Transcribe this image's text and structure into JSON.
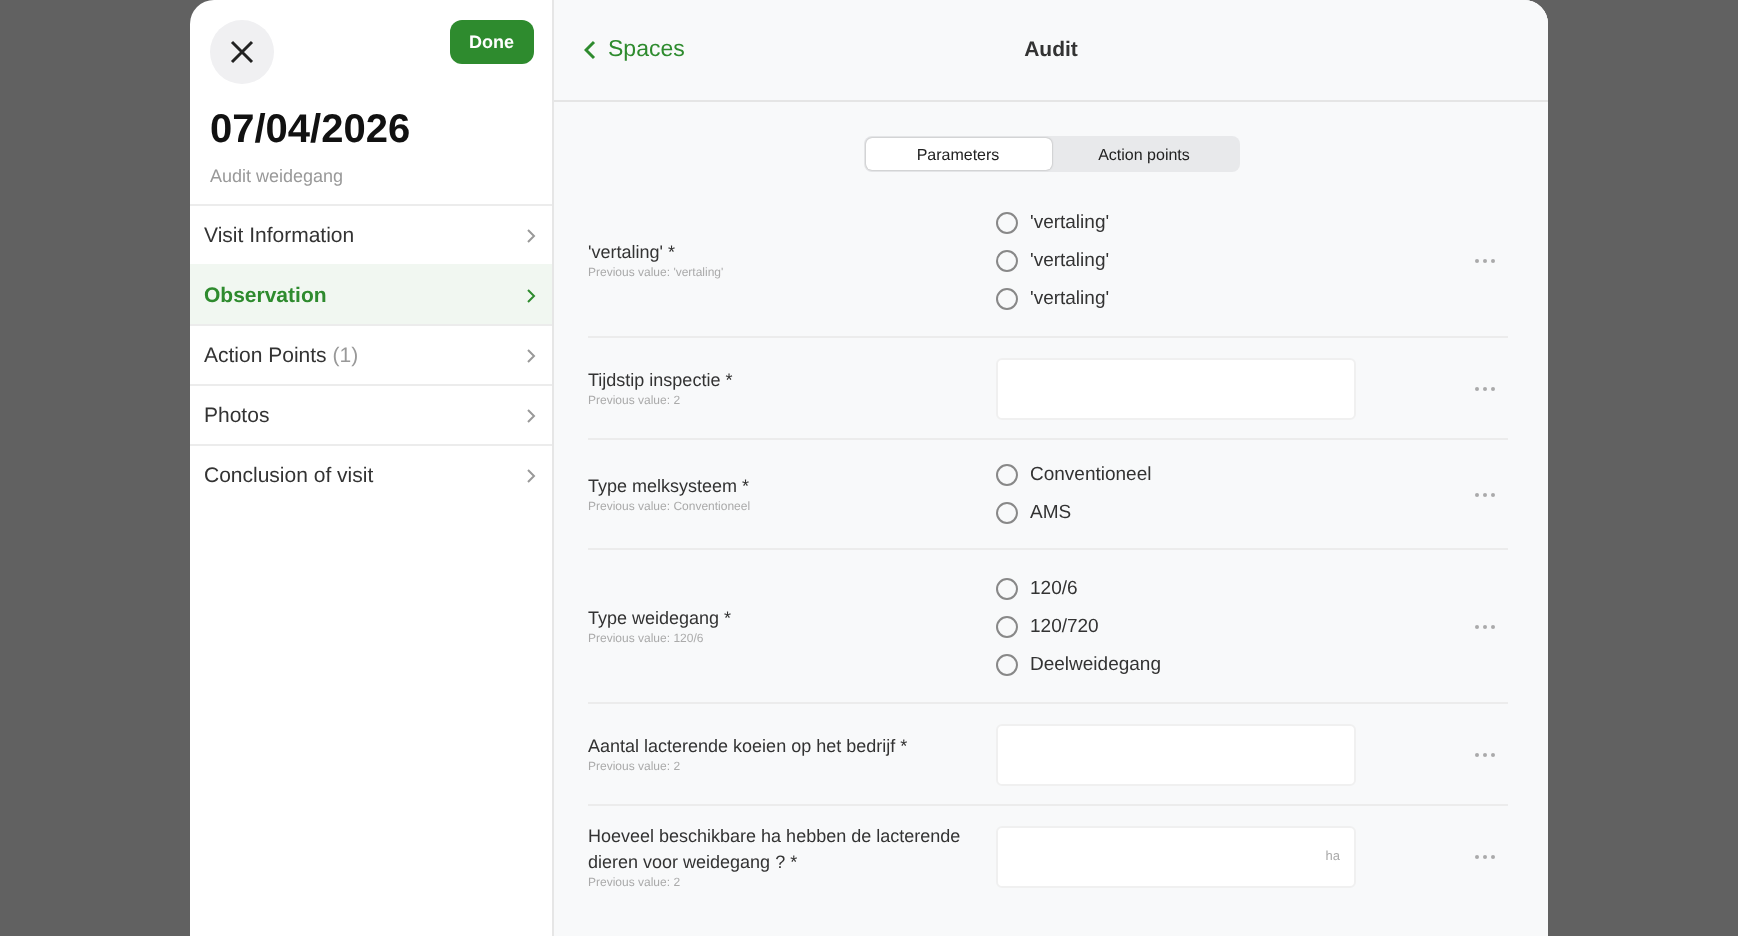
{
  "sidebar": {
    "date": "07/04/2026",
    "subtitle": "Audit weidegang",
    "done_button": "Done",
    "items": [
      {
        "label": "Visit Information",
        "selected": false
      },
      {
        "label": "Observation",
        "selected": true
      },
      {
        "label": "Action Points",
        "count": "(1)",
        "selected": false
      },
      {
        "label": "Photos",
        "selected": false
      },
      {
        "label": "Conclusion of visit",
        "selected": false
      }
    ]
  },
  "header": {
    "back": "Spaces",
    "title": "Audit"
  },
  "tabs": [
    {
      "label": "Parameters",
      "selected": true
    },
    {
      "label": "Action points",
      "selected": false
    }
  ],
  "fields": [
    {
      "kind": "radio",
      "label": "'vertaling'  *",
      "previous": "Previous value: 'vertaling'",
      "options": [
        {
          "label": "'vertaling'",
          "selected": false
        },
        {
          "label": "'vertaling'",
          "selected": false
        },
        {
          "label": "'vertaling'",
          "selected": false
        }
      ]
    },
    {
      "kind": "text",
      "label": "Tijdstip inspectie  *",
      "previous": "Previous value: 2"
    },
    {
      "kind": "radio",
      "label": "Type melksysteem  *",
      "previous": "Previous value: Conventioneel",
      "options": [
        {
          "label": "Conventioneel",
          "selected": false
        },
        {
          "label": "AMS",
          "selected": false
        }
      ]
    },
    {
      "kind": "radio",
      "label": "Type weidegang  *",
      "previous": "Previous value: 120/6",
      "options": [
        {
          "label": "120/6",
          "selected": false
        },
        {
          "label": "120/720",
          "selected": false
        },
        {
          "label": "Deelweidegang",
          "selected": false
        }
      ]
    },
    {
      "kind": "text",
      "label": "Aantal lacterende koeien op het bedrijf  *",
      "previous": "Previous value: 2"
    },
    {
      "kind": "text",
      "label": "Hoeveel beschikbare ha hebben de lacterende dieren voor weidegang ?  *",
      "previous": "Previous value: 2",
      "unit": "ha"
    }
  ]
}
